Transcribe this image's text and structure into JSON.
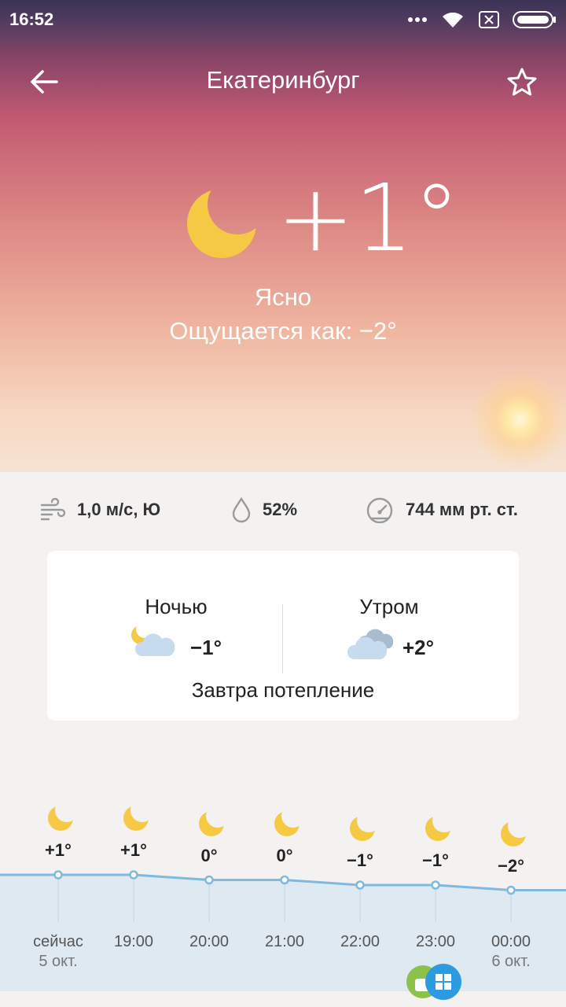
{
  "status_bar": {
    "time": "16:52",
    "icons": [
      "more-dots-icon",
      "wifi-icon",
      "sim-off-icon",
      "battery-icon"
    ]
  },
  "app_bar": {
    "title": "Екатеринбург",
    "back_icon": "arrow-left-icon",
    "favorite_icon": "star-outline-icon"
  },
  "current": {
    "icon": "moon-icon",
    "temperature": "+1°",
    "condition": "Ясно",
    "feels_like": "Ощущается как: −2°"
  },
  "details": {
    "wind": "1,0 м/с, Ю",
    "humidity": "52%",
    "pressure": "744 мм рт. ст."
  },
  "forecast_card": {
    "night": {
      "label": "Ночью",
      "temp": "−1°",
      "icon": "moon-cloud-icon"
    },
    "morning": {
      "label": "Утром",
      "temp": "+2°",
      "icon": "cloudy-icon"
    },
    "summary": "Завтра потепление"
  },
  "hourly": [
    {
      "time": "сейчас",
      "date": "5 окт.",
      "temp": "+1°",
      "value": 1
    },
    {
      "time": "19:00",
      "date": "",
      "temp": "+1°",
      "value": 1
    },
    {
      "time": "20:00",
      "date": "",
      "temp": "0°",
      "value": 0
    },
    {
      "time": "21:00",
      "date": "",
      "temp": "0°",
      "value": 0
    },
    {
      "time": "22:00",
      "date": "",
      "temp": "−1°",
      "value": -1
    },
    {
      "time": "23:00",
      "date": "",
      "temp": "−1°",
      "value": -1
    },
    {
      "time": "00:00",
      "date": "6 окт.",
      "temp": "−2°",
      "value": -2
    }
  ],
  "colors": {
    "accent_line": "#7fb9e0",
    "moon": "#f6c945"
  }
}
